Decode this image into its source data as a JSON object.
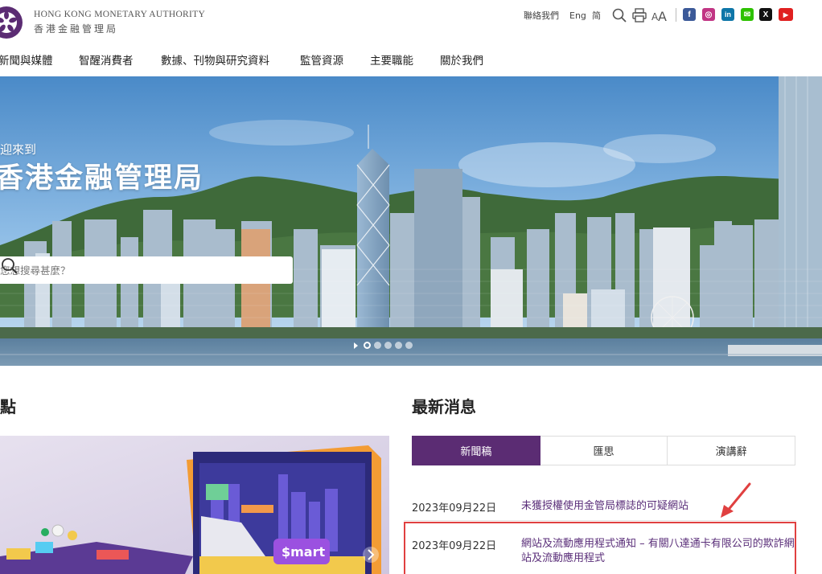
{
  "header": {
    "org_name_en": "HONG KONG MONETARY AUTHORITY",
    "org_name_zh": "香港金融管理局",
    "contact_label": "聯絡我們",
    "lang_eng": "Eng",
    "lang_sc": "简",
    "icons": [
      "search-icon",
      "print-icon",
      "font-size-icon"
    ],
    "social": [
      {
        "name": "facebook",
        "glyph": "f",
        "color": "#3b5998"
      },
      {
        "name": "instagram",
        "glyph": "◎",
        "color": "#c13584"
      },
      {
        "name": "linkedin",
        "glyph": "in",
        "color": "#0e76a8"
      },
      {
        "name": "wechat",
        "glyph": "✉",
        "color": "#2dc100"
      },
      {
        "name": "x",
        "glyph": "X",
        "color": "#111111"
      },
      {
        "name": "youtube",
        "glyph": "▶",
        "color": "#e02020"
      }
    ]
  },
  "nav": {
    "items": [
      "新聞與媒體",
      "智醒消費者",
      "數據、刊物與研究資料",
      "監管資源",
      "主要職能",
      "關於我們"
    ]
  },
  "hero": {
    "welcome": "迎來到",
    "title": "香港金融管理局",
    "search_placeholder": "您想搜尋甚麼？",
    "slide_count": 5,
    "active_slide": 1
  },
  "highlights": {
    "heading": "點"
  },
  "latest": {
    "heading": "最新消息",
    "tabs": [
      {
        "label": "新聞稿",
        "active": true
      },
      {
        "label": "匯思",
        "active": false
      },
      {
        "label": "演講辭",
        "active": false
      }
    ],
    "items": [
      {
        "date": "2023年09月22日",
        "title": "未獲授權使用金管局標誌的可疑網站"
      },
      {
        "date": "2023年09月22日",
        "title": "網站及流動應用程式通知 – 有關八達通卡有限公司的欺詐網站及流動應用程式"
      }
    ]
  },
  "colors": {
    "brand_purple": "#5b2c73",
    "link_purple": "#5a2e79",
    "annotation_red": "#e04040"
  }
}
